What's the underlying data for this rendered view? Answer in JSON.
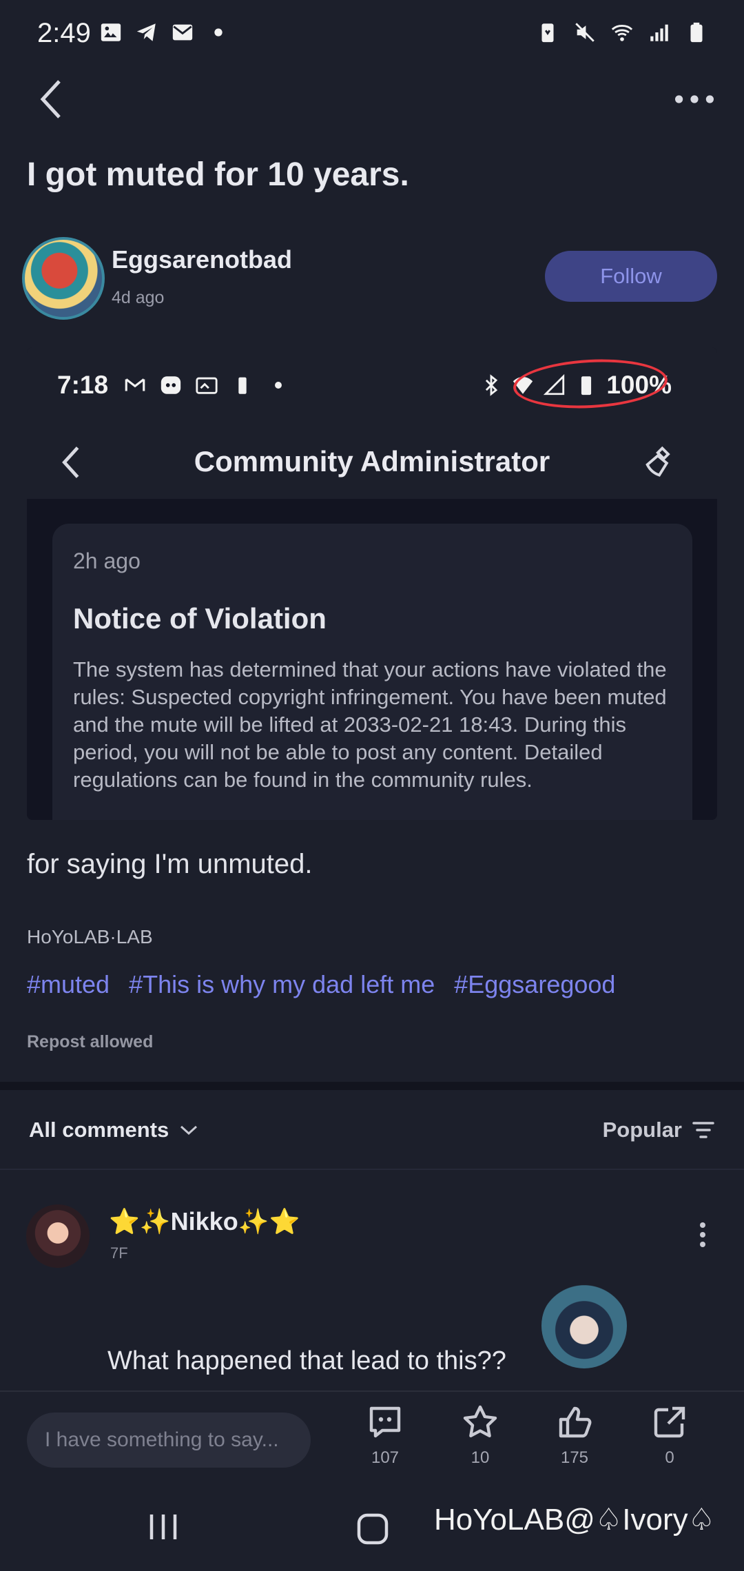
{
  "status_bar": {
    "time": "2:49",
    "left_icons": [
      "image-icon",
      "telegram-icon",
      "mail-icon",
      "dot-icon"
    ],
    "right_icons": [
      "battery-saver-icon",
      "mute-icon",
      "wifi-icon",
      "signal-icon",
      "battery-icon"
    ]
  },
  "header": {
    "back_icon": "chevron-left-icon",
    "more_icon": "more-horizontal-icon"
  },
  "post": {
    "title": "I got muted for 10 years.",
    "author": {
      "name": "Eggsarenotbad",
      "time": "4d ago",
      "follow_label": "Follow"
    },
    "embedded_screenshot": {
      "status_time": "7:18",
      "battery_text": "100%",
      "header_title": "Community Administrator",
      "notice": {
        "time": "2h ago",
        "title": "Notice of Violation",
        "body": "The system has determined that your actions have violated the rules: Suspected copyright infringement. You have been muted and the mute will be lifted at 2033-02-21 18:43. During this period, you will not be able to post any content. Detailed regulations can be found in the community rules.",
        "highlighted_date": "2033-02-21"
      }
    },
    "text": "for saying I'm unmuted.",
    "source": "HoYoLAB·LAB",
    "hashtags": [
      "#muted",
      "#This is why my dad left me",
      "#Eggsaregood"
    ],
    "repost_label": "Repost allowed"
  },
  "comments": {
    "filter_label": "All comments",
    "sort_label": "Popular",
    "items": [
      {
        "name": "⭐✨Nikko✨⭐",
        "floor": "7F",
        "text": "What happened that lead to this??"
      }
    ]
  },
  "bottom_bar": {
    "input_placeholder": "I have something to say...",
    "actions": [
      {
        "icon": "comment-icon",
        "count": "107"
      },
      {
        "icon": "collect-star-icon",
        "count": "10"
      },
      {
        "icon": "like-icon",
        "count": "175"
      },
      {
        "icon": "share-icon",
        "count": "0"
      }
    ]
  },
  "watermark": "HoYoLAB@♤Ivory♤"
}
